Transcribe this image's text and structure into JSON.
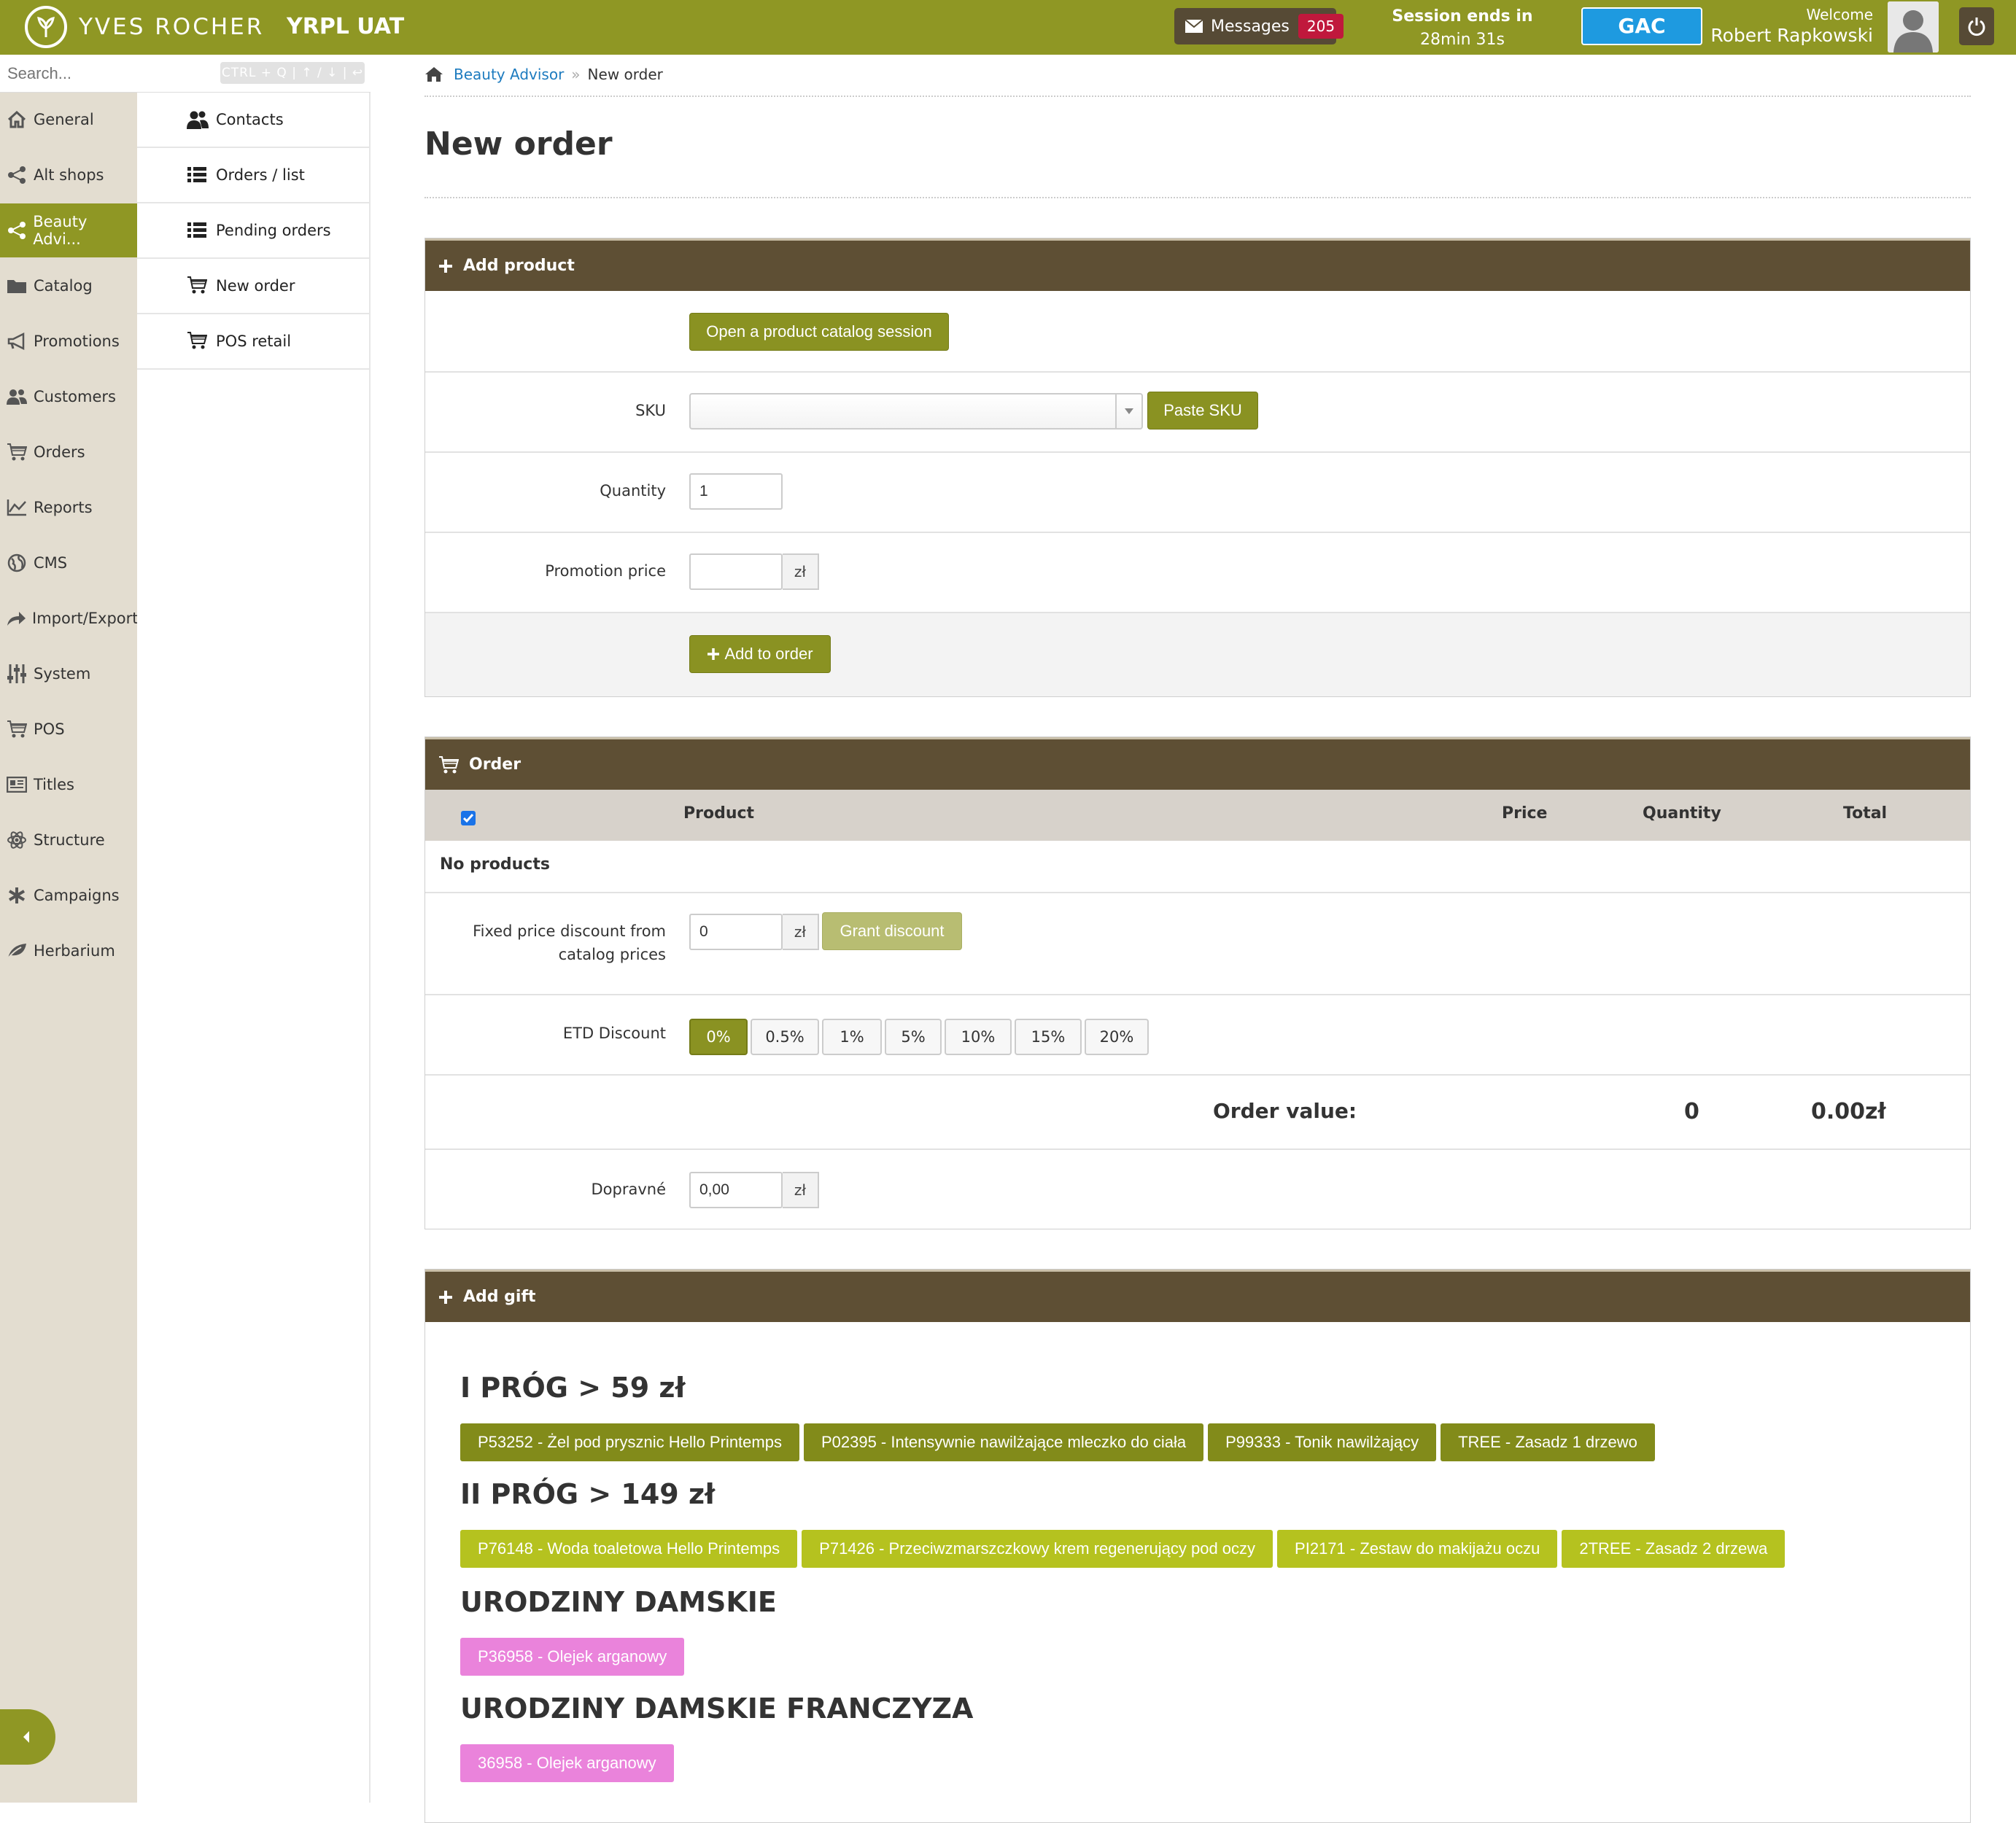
{
  "header": {
    "brand": "YVES ROCHER",
    "environment": "YRPL UAT",
    "messages_label": "Messages",
    "messages_count": "205",
    "session_label": "Session ends in",
    "session_time": "28min 31s",
    "gac_label": "GAC",
    "welcome_label": "Welcome",
    "user_name": "Robert Rapkowski",
    "icons": {
      "logo": "leaf-logo-icon",
      "messages": "envelope-icon",
      "avatar": "user-silhouette-icon",
      "power": "power-icon"
    }
  },
  "search": {
    "placeholder": "Search...",
    "hint": "CTRL + Q | ↑ / ↓ | ↩"
  },
  "sidebar": {
    "items": [
      {
        "label": "General",
        "icon": "home-icon"
      },
      {
        "label": "Alt shops",
        "icon": "share-icon"
      },
      {
        "label": "Beauty Advi...",
        "icon": "share-icon",
        "active": true
      },
      {
        "label": "Catalog",
        "icon": "folder-icon"
      },
      {
        "label": "Promotions",
        "icon": "megaphone-icon"
      },
      {
        "label": "Customers",
        "icon": "users-icon"
      },
      {
        "label": "Orders",
        "icon": "cart-icon"
      },
      {
        "label": "Reports",
        "icon": "chart-icon"
      },
      {
        "label": "CMS",
        "icon": "globe-icon"
      },
      {
        "label": "Import/Export",
        "icon": "share-arrow-icon"
      },
      {
        "label": "System",
        "icon": "sliders-icon"
      },
      {
        "label": "POS",
        "icon": "cart-icon"
      },
      {
        "label": "Titles",
        "icon": "newspaper-icon"
      },
      {
        "label": "Structure",
        "icon": "atom-icon"
      },
      {
        "label": "Campaigns",
        "icon": "asterisk-icon"
      },
      {
        "label": "Herbarium",
        "icon": "leaf-icon"
      }
    ],
    "collapse_icon": "caret-left-icon"
  },
  "subnav": {
    "items": [
      {
        "label": "Contacts",
        "icon": "users-icon"
      },
      {
        "label": "Orders / list",
        "icon": "list-icon"
      },
      {
        "label": "Pending orders",
        "icon": "list-icon"
      },
      {
        "label": "New order",
        "icon": "cart-icon"
      },
      {
        "label": "POS retail",
        "icon": "cart-icon"
      }
    ]
  },
  "breadcrumb": {
    "link": "Beauty Advisor",
    "separator": "»",
    "current": "New order"
  },
  "page_title": "New order",
  "add_product": {
    "title": "Add product",
    "catalog_button": "Open a product catalog session",
    "sku_label": "SKU",
    "sku_value": "",
    "paste_sku": "Paste SKU",
    "quantity_label": "Quantity",
    "quantity_value": "1",
    "promo_label": "Promotion price",
    "promo_value": "",
    "currency": "zł",
    "add_button": "Add to order"
  },
  "order": {
    "title": "Order",
    "columns": [
      "Product",
      "Price",
      "Quantity",
      "Total"
    ],
    "no_products": "No products",
    "fixed_discount_label_1": "Fixed price discount from",
    "fixed_discount_label_2": "catalog prices",
    "fixed_discount_value": "0",
    "currency": "zł",
    "grant_discount": "Grant discount",
    "etd_label": "ETD Discount",
    "etd_options": [
      "0%",
      "0.5%",
      "1%",
      "5%",
      "10%",
      "15%",
      "20%"
    ],
    "etd_selected": "0%",
    "order_value_label": "Order value:",
    "order_quantity": "0",
    "order_total": "0.00zł",
    "shipping_label": "Dopravné",
    "shipping_value": "0,00"
  },
  "add_gift": {
    "title": "Add gift",
    "groups": [
      {
        "heading": "I PRÓG > 59 zł",
        "color": "#828b1a",
        "items": [
          "P53252 - Żel pod prysznic Hello Printemps",
          "P02395 - Intensywnie nawilżające mleczko do ciała",
          "P99333 - Tonik nawilżający",
          "TREE - Zasadz 1 drzewo"
        ]
      },
      {
        "heading": "II PRÓG > 149 zł",
        "color": "#b5c21f",
        "items": [
          "P76148 - Woda toaletowa Hello Printemps",
          "P71426 - Przeciwzmarszczkowy krem regenerujący pod oczy",
          "PI2171 - Zestaw do makijażu oczu",
          "2TREE - Zasadz 2 drzewa"
        ]
      },
      {
        "heading": "URODZINY DAMSKIE",
        "color": "#ea83db",
        "items": [
          "P36958 - Olejek arganowy"
        ]
      },
      {
        "heading": "URODZINY DAMSKIE FRANCZYZA",
        "color": "#ea83db",
        "items": [
          "36958 - Olejek arganowy"
        ]
      }
    ]
  },
  "colors": {
    "brand_olive": "#8f9724",
    "panel_header": "#5e4f34",
    "sidebar_bg": "#e3ddd0",
    "link_blue": "#1d7bbf",
    "gac_blue": "#1e9ae0",
    "badge_red": "#c0183c"
  }
}
